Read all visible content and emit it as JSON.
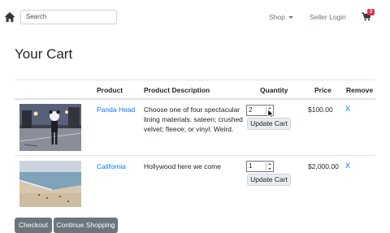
{
  "navbar": {
    "search_placeholder": "Search",
    "shop_label": "Shop",
    "seller_login_label": "Seller Login",
    "cart_count": "2"
  },
  "page": {
    "title": "Your Cart"
  },
  "table": {
    "headers": [
      "Product",
      "Product Description",
      "Quantity",
      "Price",
      "Remove"
    ],
    "rows": [
      {
        "product": "Panda Head",
        "description": "Choose one of four spectacular lining materials: sateen; crushed velvet; fleece; or vinyl. Weird.",
        "quantity": "2",
        "update_label": "Update Cart",
        "price": "$100.00",
        "remove_label": "X",
        "image": "panda-head-photo"
      },
      {
        "product": "California",
        "description": "Hollywood here we come",
        "quantity": "1",
        "update_label": "Update Cart",
        "price": "$2,000.00",
        "remove_label": "X",
        "image": "beach-photo"
      }
    ]
  },
  "actions": {
    "checkout_label": "Checkout",
    "continue_label": "Continue Shopping"
  },
  "colors": {
    "link": "#007bff",
    "badge": "#dc3545",
    "button_dark": "#6c757d"
  }
}
